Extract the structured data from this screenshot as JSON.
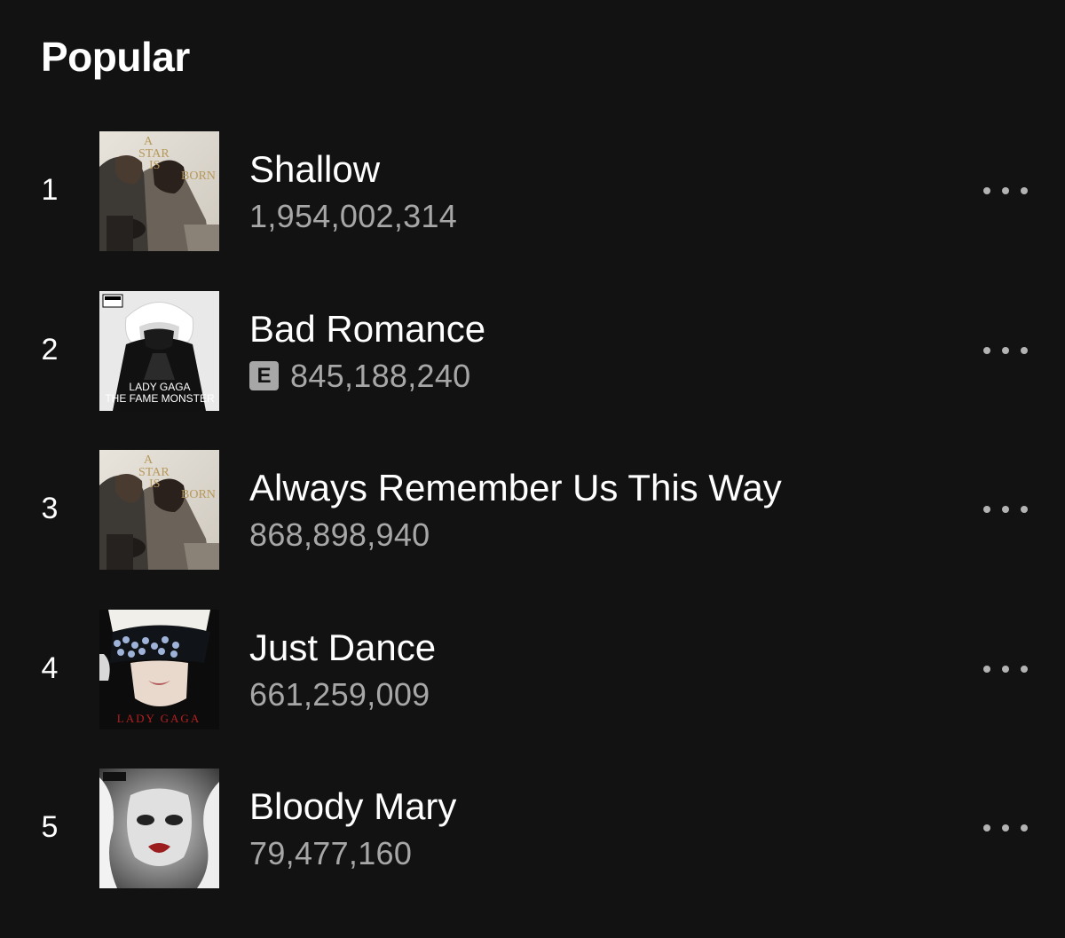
{
  "section": {
    "title": "Popular"
  },
  "tracks": [
    {
      "number": "1",
      "title": "Shallow",
      "plays": "1,954,002,314",
      "explicit": false,
      "cover_icon": "a-star-is-born-cover"
    },
    {
      "number": "2",
      "title": "Bad Romance",
      "plays": "845,188,240",
      "explicit": true,
      "explicit_label": "E",
      "cover_icon": "the-fame-monster-cover",
      "cover_text_line1": "LADY GAGA",
      "cover_text_line2": "THE FAME MONSTER"
    },
    {
      "number": "3",
      "title": "Always Remember Us This Way",
      "plays": "868,898,940",
      "explicit": false,
      "cover_icon": "a-star-is-born-cover"
    },
    {
      "number": "4",
      "title": "Just Dance",
      "plays": "661,259,009",
      "explicit": false,
      "cover_icon": "the-fame-cover",
      "cover_text_line1": "LADY GAGA"
    },
    {
      "number": "5",
      "title": "Bloody Mary",
      "plays": "79,477,160",
      "explicit": false,
      "cover_icon": "born-this-way-cover"
    }
  ],
  "colors": {
    "background": "#121212",
    "primary_text": "#ffffff",
    "secondary_text": "#a7a7a7"
  }
}
